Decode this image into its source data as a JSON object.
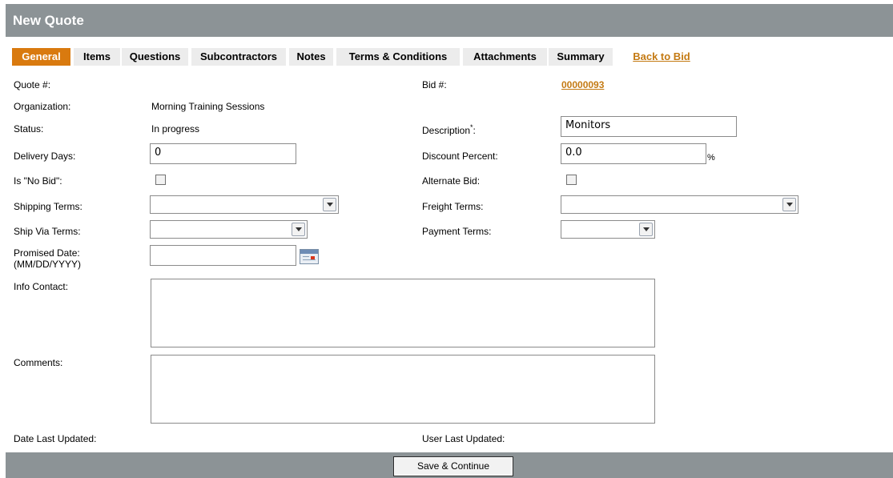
{
  "window": {
    "title": "New Quote"
  },
  "tabs": [
    {
      "label": "General",
      "active": true
    },
    {
      "label": "Items"
    },
    {
      "label": "Questions"
    },
    {
      "label": "Subcontractors"
    },
    {
      "label": "Notes"
    },
    {
      "label": "Terms & Conditions"
    },
    {
      "label": "Attachments"
    },
    {
      "label": "Summary"
    }
  ],
  "back_link": "Back to Bid",
  "form": {
    "quote_number_label": "Quote #:",
    "quote_number_value": "",
    "bid_number_label": "Bid #:",
    "bid_number_value": "00000093",
    "organization_label": "Organization:",
    "organization_value": "Morning Training Sessions",
    "status_label": "Status:",
    "status_value": "In progress",
    "description_label": "Description",
    "description_required_mark": "*",
    "description_label_suffix": ":",
    "description_value": "Monitors",
    "delivery_days_label": "Delivery Days:",
    "delivery_days_value": "0",
    "discount_percent_label": "Discount Percent:",
    "discount_percent_value": "0.0",
    "discount_percent_unit": "%",
    "no_bid_label": "Is \"No Bid\":",
    "no_bid_checked": false,
    "alternate_bid_label": "Alternate Bid:",
    "alternate_bid_checked": false,
    "shipping_terms_label": "Shipping Terms:",
    "shipping_terms_value": "",
    "freight_terms_label": "Freight Terms:",
    "freight_terms_value": "",
    "ship_via_terms_label": "Ship Via Terms:",
    "ship_via_terms_value": "",
    "payment_terms_label": "Payment Terms:",
    "payment_terms_value": "",
    "promised_date_label_line1": "Promised Date:",
    "promised_date_label_line2": "(MM/DD/YYYY)",
    "promised_date_value": "",
    "info_contact_label": "Info Contact:",
    "info_contact_value": "",
    "comments_label": "Comments:",
    "comments_value": "",
    "date_last_updated_label": "Date Last Updated:",
    "date_last_updated_value": "",
    "user_last_updated_label": "User Last Updated:",
    "user_last_updated_value": ""
  },
  "footer": {
    "save_button": "Save & Continue"
  },
  "colors": {
    "header_bg": "#8c9396",
    "active_tab": "#d97a0f",
    "link": "#c47a13",
    "inactive_tab": "#ececec"
  },
  "icons": {
    "calendar": "calendar-icon",
    "dropdown": "chevron-down-icon"
  }
}
